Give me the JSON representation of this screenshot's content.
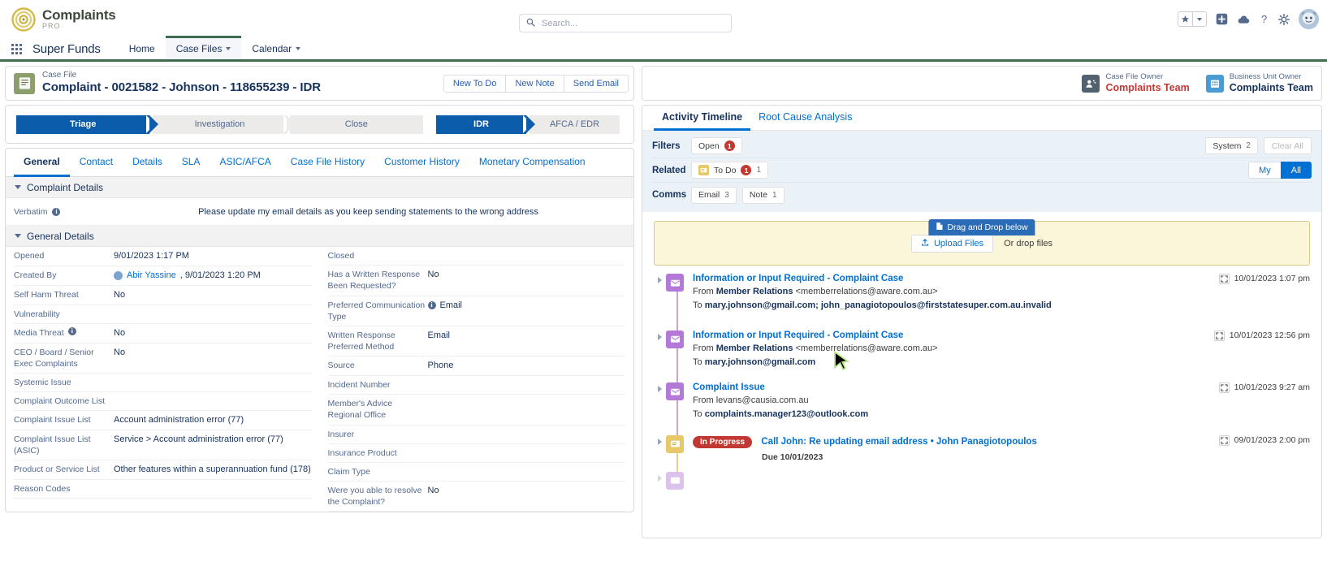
{
  "header": {
    "brand_title": "Complaints",
    "brand_sub": "PRO",
    "search_placeholder": "Search...",
    "search_value": "",
    "icons": [
      "favorites-star-icon",
      "favorites-dropdown-icon",
      "add-icon",
      "cloud-icon",
      "help-icon",
      "setup-gear-icon",
      "user-avatar"
    ]
  },
  "appnav": {
    "app_name": "Super Funds",
    "items": [
      {
        "label": "Home",
        "has_menu": false,
        "active": false
      },
      {
        "label": "Case Files",
        "has_menu": true,
        "active": true
      },
      {
        "label": "Calendar",
        "has_menu": true,
        "active": false
      }
    ]
  },
  "casefile": {
    "type_label": "Case File",
    "title": "Complaint - 0021582 - Johnson - 118655239 - IDR",
    "actions": [
      "New To Do",
      "New Note",
      "Send Email"
    ]
  },
  "path": {
    "primary": [
      {
        "label": "Triage",
        "state": "done"
      },
      {
        "label": "Investigation",
        "state": "todo"
      },
      {
        "label": "Close",
        "state": "todo"
      }
    ],
    "secondary": [
      {
        "label": "IDR",
        "state": "done"
      },
      {
        "label": "AFCA / EDR",
        "state": "todo"
      }
    ]
  },
  "detail_tabs": [
    {
      "label": "General",
      "active": true
    },
    {
      "label": "Contact",
      "active": false
    },
    {
      "label": "Details",
      "active": false
    },
    {
      "label": "SLA",
      "active": false
    },
    {
      "label": "ASIC/AFCA",
      "active": false
    },
    {
      "label": "Case File History",
      "active": false
    },
    {
      "label": "Customer History",
      "active": false
    },
    {
      "label": "Monetary Compensation",
      "active": false
    }
  ],
  "complaint_details": {
    "section_title": "Complaint Details",
    "verbatim_label": "Verbatim",
    "verbatim_value": "Please update my email details as you keep sending statements to the wrong address"
  },
  "general_details": {
    "section_title": "General Details",
    "left_fields": [
      {
        "label": "Opened",
        "value": "9/01/2023 1:17 PM",
        "info": false
      },
      {
        "label": "Created By",
        "value": "Abir Yassine, 9/01/2023 1:20 PM",
        "link_text": "Abir Yassine",
        "rest_text": ", 9/01/2023 1:20 PM",
        "avatar": true,
        "info": false
      },
      {
        "label": "Self Harm Threat",
        "value": "No",
        "info": false
      },
      {
        "label": "Vulnerability",
        "value": "",
        "info": false
      },
      {
        "label": "Media Threat",
        "value": "No",
        "info": true
      },
      {
        "label": "CEO / Board / Senior Exec Complaints",
        "value": "No",
        "info": false
      },
      {
        "label": "Systemic Issue",
        "value": "",
        "info": false
      },
      {
        "label": "Complaint Outcome List",
        "value": "",
        "info": false
      },
      {
        "label": "Complaint Issue List",
        "value": "Account administration error (77)",
        "info": false
      },
      {
        "label": "Complaint Issue List (ASIC)",
        "value": "Service > Account administration error (77)",
        "info": false
      },
      {
        "label": "Product or Service List",
        "value": "Other features within a superannuation fund (178)",
        "info": false
      },
      {
        "label": "Reason Codes",
        "value": "",
        "info": false
      }
    ],
    "right_fields": [
      {
        "label": "Closed",
        "value": "",
        "info": false
      },
      {
        "label": "Has a Written Response Been Requested?",
        "value": "No",
        "info": false
      },
      {
        "label": "Preferred Communication Type",
        "value": "Email",
        "info": true
      },
      {
        "label": "Written Response Preferred Method",
        "value": "Email",
        "info": false
      },
      {
        "label": "Source",
        "value": "Phone",
        "info": false
      },
      {
        "label": "Incident Number",
        "value": "",
        "info": false
      },
      {
        "label": "Member's Advice Regional Office",
        "value": "",
        "info": false
      },
      {
        "label": "Insurer",
        "value": "",
        "info": false
      },
      {
        "label": "Insurance Product",
        "value": "",
        "info": false
      },
      {
        "label": "Claim Type",
        "value": "",
        "info": false
      },
      {
        "label": "Were you able to resolve the Complaint?",
        "value": "No",
        "info": false
      }
    ]
  },
  "owners": [
    {
      "label": "Case File Owner",
      "name": "Complaints Team",
      "color": "#c23934",
      "icon": "case-owner-icon",
      "icon_bg": "#52616f"
    },
    {
      "label": "Business Unit Owner",
      "name": "Complaints Team",
      "color": "#16325c",
      "icon": "business-unit-icon",
      "icon_bg": "#4a9ad4"
    }
  ],
  "timeline": {
    "tabs": [
      {
        "label": "Activity Timeline",
        "active": true
      },
      {
        "label": "Root Cause Analysis",
        "active": false
      }
    ],
    "filters": {
      "filters_label": "Filters",
      "related_label": "Related",
      "comms_label": "Comms",
      "filters_pills": [
        {
          "label": "Open",
          "badge": "1"
        }
      ],
      "related_pills": [
        {
          "label": "To Do",
          "badge": "1",
          "count": "1",
          "icon": "todo-icon"
        }
      ],
      "comms_pills": [
        {
          "label": "Email",
          "count": "3"
        },
        {
          "label": "Note",
          "count": "1"
        }
      ],
      "system_pill": {
        "label": "System",
        "count": "2"
      },
      "clear_all_label": "Clear All",
      "scope_my": "My",
      "scope_all": "All",
      "scope_selected": "All"
    },
    "dropzone": {
      "tab_label": "Drag and Drop below",
      "upload_label": "Upload Files",
      "hint": "Or drop files"
    },
    "entries": [
      {
        "kind": "email",
        "title": "Information or Input Required - Complaint Case",
        "from_prefix": "From",
        "from_name": "Member Relations",
        "from_email": "<memberrelations@aware.com.au>",
        "to_prefix": "To",
        "to_value": "mary.johnson@gmail.com; john_panagiotopoulos@firststatesuper.com.au.invalid",
        "date": "10/01/2023 1:07 pm"
      },
      {
        "kind": "email",
        "title": "Information or Input Required - Complaint Case",
        "from_prefix": "From",
        "from_name": "Member Relations",
        "from_email": "<memberrelations@aware.com.au>",
        "to_prefix": "To",
        "to_value": "mary.johnson@gmail.com",
        "date": "10/01/2023 12:56 pm"
      },
      {
        "kind": "email",
        "title": "Complaint Issue",
        "from_prefix": "From",
        "from_name": "",
        "from_email": "levans@causia.com.au",
        "to_prefix": "To",
        "to_value": "complaints.manager123@outlook.com",
        "date": "10/01/2023 9:27 am"
      },
      {
        "kind": "task",
        "status": "In Progress",
        "title": "Call John: Re updating email address • John Panagiotopoulos",
        "due_label": "Due 10/01/2023",
        "date": "09/01/2023 2:00 pm"
      }
    ]
  }
}
